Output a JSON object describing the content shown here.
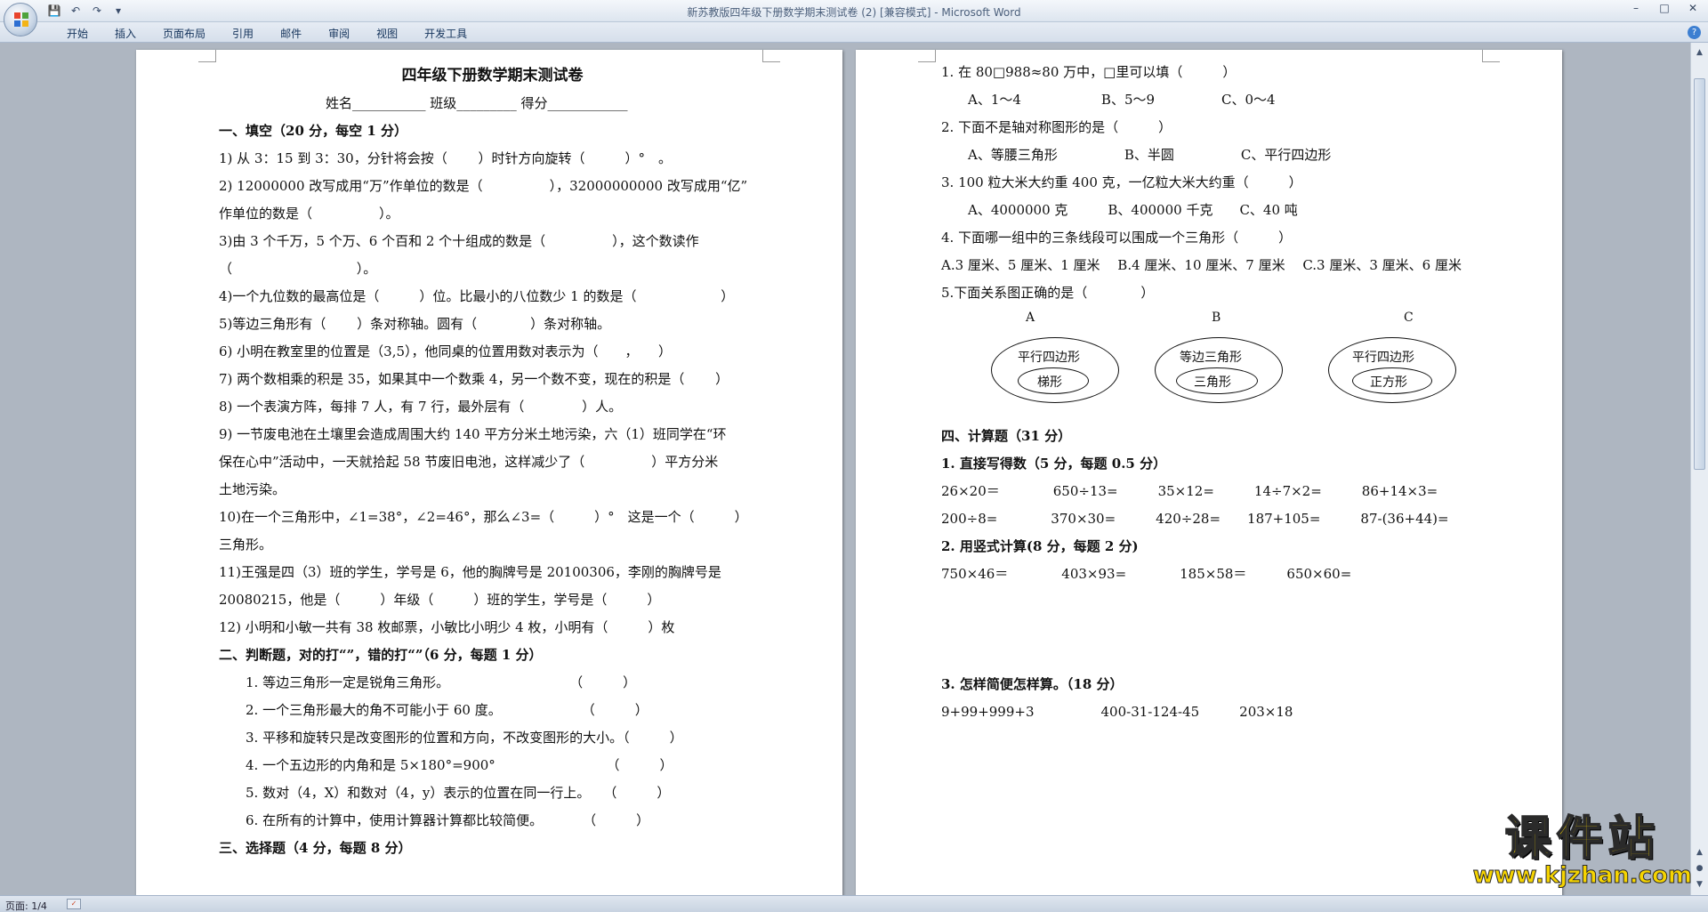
{
  "window": {
    "title": "新苏教版四年级下册数学期末测试卷 (2) [兼容模式] - Microsoft Word"
  },
  "ribbon": {
    "tabs": [
      "开始",
      "插入",
      "页面布局",
      "引用",
      "邮件",
      "审阅",
      "视图",
      "开发工具"
    ]
  },
  "left_page": {
    "title": "四年级下册数学期末测试卷",
    "header_fields": "姓名___________    班级_________    得分____________",
    "lines": [
      "一、填空（20 分，每空 1 分）",
      "1) 从 3：15 到 3：30，分针将会按（　　 ）时针方向旋转（　　　）°　。",
      "2) 12000000 改写成用“万”作单位的数是（　　　　　），32000000000 改写成用“亿”",
      "作单位的数是（　　　　　）。",
      "3)由 3 个千万，5 个万、6 个百和 2 个十组成的数是（　　　　　），这个数读作",
      "（　　　　　　　　　 ）。",
      "4)一个九位数的最高位是（　　　）位。比最小的八位数少 1 的数是（　　　　　　 ）",
      "5)等边三角形有（　　 ）条对称轴。圆有（　　　　）条对称轴。",
      "6) 小明在教室里的位置是（3,5），他同桌的位置用数对表示为（　　，　　）",
      "7) 两个数相乘的积是 35，如果其中一个数乘 4，另一个数不变，现在的积是（　　 ）",
      "8) 一个表演方阵，每排 7 人，有 7 行，最外层有（　　　　 ）人。",
      "9) 一节废电池在土壤里会造成周围大约 140 平方分米土地污染，六（1）班同学在“环",
      "保在心中”活动中，一天就拾起 58 节废旧电池，这样减少了（　　　　　）平方分米",
      "土地污染。",
      "10)在一个三角形中，∠1=38°，∠2=46°，那么∠3=（　　　）°　这是一个（　　　）",
      "三角形。",
      "11)王强是四（3）班的学生，学号是 6，他的胸牌号是 20100306，李刚的胸牌号是",
      "20080215，他是（　　　）年级（　　　）班的学生，学号是（　　　）",
      "12) 小明和小敏一共有 38 枚邮票，小敏比小明少 4 枚，小明有（　　　）枚",
      "二、判断题，对的打“”，错的打“”（6 分，每题 1 分）",
      "1. 等边三角形一定是锐角三角形。　　　　　　　　　　（　　　）",
      "2. 一个三角形最大的角不可能小于 60 度。　　　　　　　（　　　）",
      "3. 平移和旋转只是改变图形的位置和方向，不改变图形的大小。（　　　）",
      "4. 一个五边形的内角和是 5×180°=900°　　　　　　　　 （　　　）",
      "5. 数对（4，X）和数对（4，y）表示的位置在同一行上。　　（　　　）",
      "6. 在所有的计算中，使用计算器计算都比较简便。　　　　（　　　）",
      "三、选择题（4 分，每题 8 分）"
    ]
  },
  "right_page": {
    "lines_top": [
      "1. 在 80□988≈80 万中，□里可以填（　　　）",
      "A、1～4　　　　　　B、5～9　　　　　C、0～4",
      "2. 下面不是轴对称图形的是（　　　）",
      "A、等腰三角形　　　　　B、半圆　　　　　C、平行四边形",
      "3. 100 粒大米大约重 400 克，一亿粒大米大约重（　　　）",
      "A、4000000 克　　　B、400000 千克　　C、40 吨",
      "4. 下面哪一组中的三条线段可以围成一个三角形（　　　）",
      "A.3 厘米、5 厘米、1 厘米　 B.4 厘米、10 厘米、7 厘米　 C.3 厘米、3 厘米、6 厘米",
      "5.下面关系图正确的是（　　　　）"
    ],
    "venn": {
      "labels": [
        "A",
        "B",
        "C"
      ],
      "outer": [
        "平行四边形",
        "等边三角形",
        "平行四边形"
      ],
      "inner": [
        "梯形",
        "三角形",
        "正方形"
      ]
    },
    "lines_bottom": [
      "四、计算题（31 分）",
      "1. 直接写得数（5 分，每题 0.5 分）",
      "26×20＝　　　　650÷13=　　　35×12=　　　14÷7×2=　　　86+14×3=",
      "200÷8=　　　　370×30=　　　420÷28=　　187+105=　　　87-(36+44)=",
      "2. 用竖式计算(8 分，每题 2 分)",
      "750×46＝　　　　403×93=　　　　185×58＝　　　650×60=",
      "",
      "",
      "",
      "3. 怎样简便怎样算。（18 分）",
      "9+99+999+3　　　　　400-31-124-45　　　203×18",
      "",
      "",
      "",
      ""
    ]
  },
  "status": {
    "page": "页面: 1/4"
  },
  "watermark": {
    "main": "课件站",
    "url": "www.kjzhan.com"
  }
}
